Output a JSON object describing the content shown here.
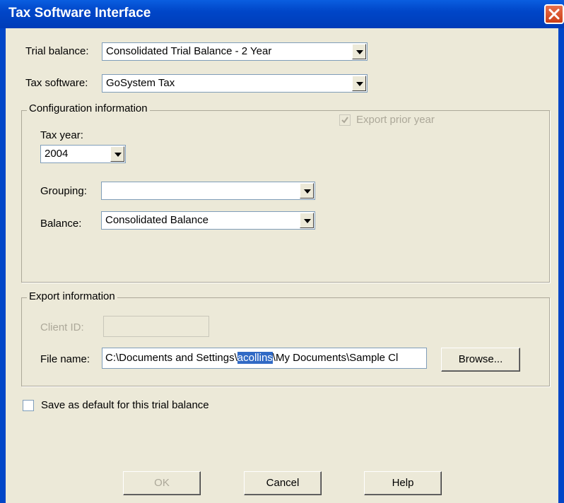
{
  "window": {
    "title": "Tax Software Interface"
  },
  "trial_balance": {
    "label": "Trial balance:",
    "value": "Consolidated Trial Balance - 2 Year"
  },
  "tax_software": {
    "label": "Tax software:",
    "value": "GoSystem Tax"
  },
  "config": {
    "title": "Configuration information",
    "export_prior_year": {
      "label": "Export prior year",
      "checked": true,
      "enabled": false
    },
    "tax_year": {
      "label": "Tax year:",
      "value": "2004"
    },
    "grouping": {
      "label": "Grouping:",
      "value": ""
    },
    "balance": {
      "label": "Balance:",
      "value": "Consolidated Balance"
    }
  },
  "export": {
    "title": "Export information",
    "client_id": {
      "label": "Client ID:",
      "value": "",
      "enabled": false
    },
    "file_name": {
      "label": "File name:",
      "value_before": "C:\\Documents and Settings\\",
      "value_selected": "acollins",
      "value_after": "\\My Documents\\Sample Cl"
    },
    "browse_label": "Browse..."
  },
  "save_default": {
    "label": "Save as default for this trial balance",
    "checked": false
  },
  "buttons": {
    "ok": "OK",
    "cancel": "Cancel",
    "help": "Help"
  },
  "colors": {
    "titlebar": "#0046c8",
    "dialog_bg": "#ece9d8",
    "selection": "#316ac5"
  }
}
